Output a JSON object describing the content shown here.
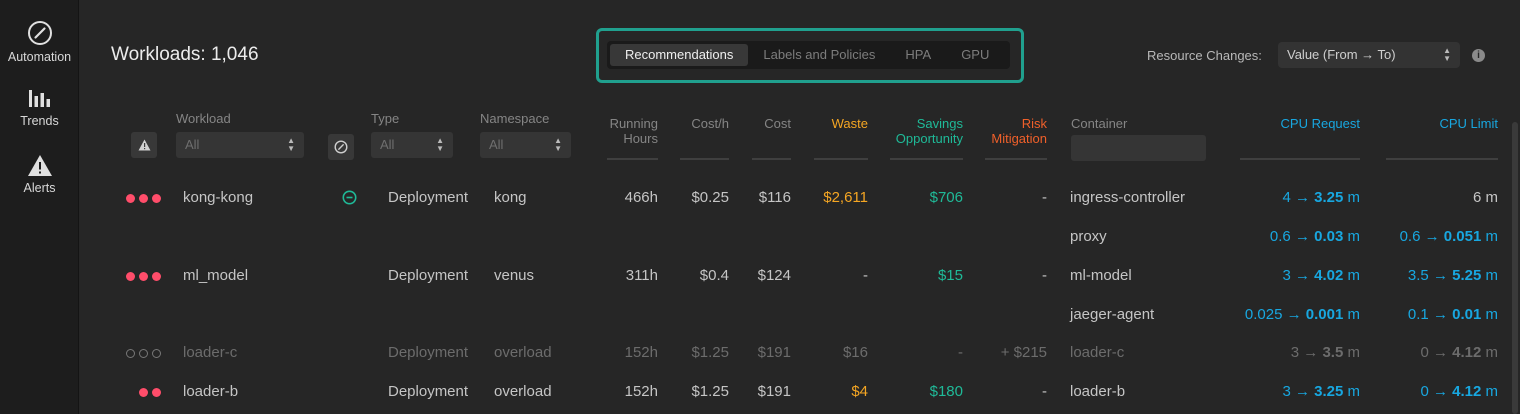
{
  "sidebar": {
    "items": [
      {
        "label": "Automation",
        "icon": "compass-icon"
      },
      {
        "label": "Trends",
        "icon": "bar-chart-icon"
      },
      {
        "label": "Alerts",
        "icon": "warning-icon"
      }
    ]
  },
  "header": {
    "title": "Workloads: 1,046",
    "tabs": [
      "Recommendations",
      "Labels and Policies",
      "HPA",
      "GPU"
    ],
    "active_tab": "Recommendations",
    "resource_changes_label": "Resource Changes:",
    "resource_changes_value": "Value (From → To)"
  },
  "columns": {
    "workload": "Workload",
    "type": "Type",
    "namespace": "Namespace",
    "running_hours_1": "Running",
    "running_hours_2": "Hours",
    "cost_h": "Cost/h",
    "cost": "Cost",
    "waste": "Waste",
    "savings_1": "Savings",
    "savings_2": "Opportunity",
    "risk_1": "Risk",
    "risk_2": "Mitigation",
    "container": "Container",
    "cpu_request": "CPU Request",
    "cpu_limit": "CPU Limit"
  },
  "filters": {
    "workload": "All",
    "type": "All",
    "namespace": "All"
  },
  "colors": {
    "accent": "#20a08e",
    "alert": "#ff4d6a",
    "waste": "#f5a623",
    "savings": "#1fba98",
    "risk": "#f0602a",
    "cpu": "#18a7e0"
  },
  "rows": [
    {
      "severity": 3,
      "dim": false,
      "workload": "kong-kong",
      "has_auto_icon": true,
      "type": "Deployment",
      "namespace": "kong",
      "running_hours": "466h",
      "cost_h": "$0.25",
      "cost": "$116",
      "waste": "$2,611",
      "savings": "$706",
      "risk": "-",
      "containers": [
        {
          "name": "ingress-controller",
          "req_from": "4",
          "req_to": "3.25",
          "req_unit": "m",
          "limit_plain": "6 m"
        },
        {
          "name": "proxy",
          "req_from": "0.6",
          "req_to": "0.03",
          "req_unit": "m",
          "lim_from": "0.6",
          "lim_to": "0.051",
          "lim_unit": "m"
        }
      ]
    },
    {
      "severity": 3,
      "dim": false,
      "workload": "ml_model",
      "has_auto_icon": false,
      "type": "Deployment",
      "namespace": "venus",
      "running_hours": "311h",
      "cost_h": "$0.4",
      "cost": "$124",
      "waste": "-",
      "savings": "$15",
      "risk": "-",
      "containers": [
        {
          "name": "ml-model",
          "req_from": "3",
          "req_to": "4.02",
          "req_unit": "m",
          "lim_from": "3.5",
          "lim_to": "5.25",
          "lim_unit": "m"
        },
        {
          "name": "jaeger-agent",
          "req_from": "0.025",
          "req_to": "0.001",
          "req_unit": "m",
          "lim_from": "0.1",
          "lim_to": "0.01",
          "lim_unit": "m"
        }
      ]
    },
    {
      "severity": 0,
      "dim": true,
      "workload": "loader-c",
      "has_auto_icon": false,
      "type": "Deployment",
      "namespace": "overload",
      "running_hours": "152h",
      "cost_h": "$1.25",
      "cost": "$191",
      "waste": "$16",
      "savings": "-",
      "risk": "+ $215",
      "containers": [
        {
          "name": "loader-c",
          "req_from": "3",
          "req_to": "3.5",
          "req_unit": "m",
          "lim_from": "0",
          "lim_to": "4.12",
          "lim_unit": "m"
        }
      ]
    },
    {
      "severity": 2,
      "dim": false,
      "workload": "loader-b",
      "has_auto_icon": false,
      "type": "Deployment",
      "namespace": "overload",
      "running_hours": "152h",
      "cost_h": "$1.25",
      "cost": "$191",
      "waste": "$4",
      "savings": "$180",
      "risk": "-",
      "containers": [
        {
          "name": "loader-b",
          "req_from": "3",
          "req_to": "3.25",
          "req_unit": "m",
          "lim_from": "0",
          "lim_to": "4.12",
          "lim_unit": "m"
        }
      ]
    }
  ]
}
